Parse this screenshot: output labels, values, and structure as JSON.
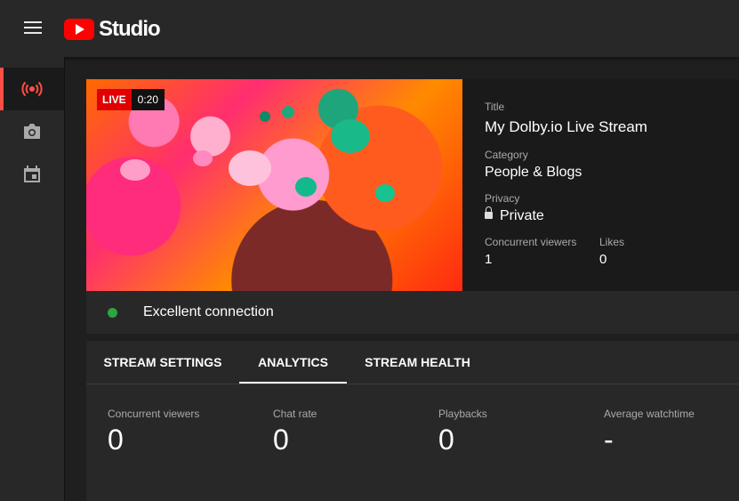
{
  "header": {
    "logo_text": "Studio"
  },
  "sidebar": {
    "items": [
      {
        "icon": "live-broadcast-icon",
        "active": true
      },
      {
        "icon": "camera-icon",
        "active": false
      },
      {
        "icon": "calendar-icon",
        "active": false
      }
    ]
  },
  "stream": {
    "live_label": "LIVE",
    "elapsed": "0:20",
    "title_label": "Title",
    "title": "My Dolby.io Live Stream",
    "category_label": "Category",
    "category": "People & Blogs",
    "privacy_label": "Privacy",
    "privacy": "Private",
    "viewers_label": "Concurrent viewers",
    "viewers": "1",
    "likes_label": "Likes",
    "likes": "0"
  },
  "connection": {
    "status": "Excellent connection",
    "color": "#2ba640"
  },
  "tabs": [
    {
      "label": "STREAM SETTINGS",
      "active": false
    },
    {
      "label": "ANALYTICS",
      "active": true
    },
    {
      "label": "STREAM HEALTH",
      "active": false
    }
  ],
  "analytics": [
    {
      "label": "Concurrent viewers",
      "value": "0"
    },
    {
      "label": "Chat rate",
      "value": "0"
    },
    {
      "label": "Playbacks",
      "value": "0"
    },
    {
      "label": "Average watchtime",
      "value": "-"
    }
  ],
  "colors": {
    "accent_red": "#ff0000",
    "active_indicator": "#ff4e45"
  }
}
